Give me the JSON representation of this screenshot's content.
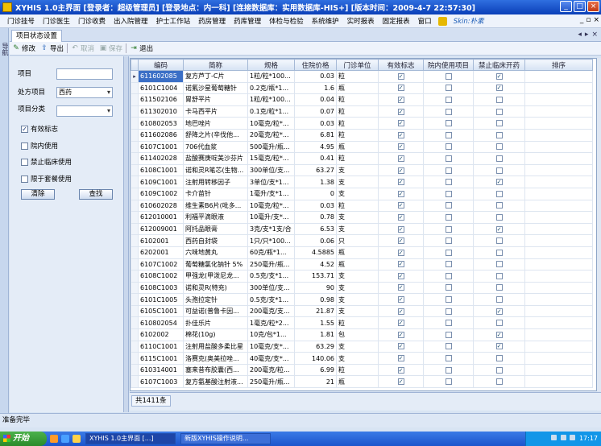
{
  "window": {
    "title": "XYHIS 1.0主界面  [登录者：超级管理员] [登录地点：内一科] [连接数据库：实用数据库-HIS+] [版本时间：2009-4-7 22:57:30]"
  },
  "menu": {
    "items": [
      "门诊挂号",
      "门诊医生",
      "门诊收费",
      "出入院管理",
      "护士工作站",
      "药房管理",
      "药库管理",
      "体检与检验",
      "系统维护",
      "实时报表",
      "固定报表",
      "窗口"
    ],
    "skin": "Skin:朴素"
  },
  "leftbar": {
    "label": "导航"
  },
  "tab": {
    "label": "项目状态设置"
  },
  "toolbar": {
    "modify": "修改",
    "export": "导出",
    "cancel": "取消",
    "save": "保存",
    "exit": "退出"
  },
  "filter": {
    "item_label": "项目",
    "item_value": "",
    "pharmacy_label": "处方项目",
    "pharmacy_value": "西药",
    "category_label": "项目分类",
    "category_value": "",
    "chk_valid": "有效标志",
    "chk_valid_checked": true,
    "chk_inhouse": "院内使用",
    "chk_inhouse_checked": false,
    "chk_banned": "禁止临床使用",
    "chk_banned_checked": false,
    "chk_restrict": "限于套餐使用",
    "chk_restrict_checked": false,
    "clear": "清除",
    "search": "查找"
  },
  "grid": {
    "columns": [
      "编码",
      "简称",
      "规格",
      "住院价格",
      "门诊单位",
      "有效标志",
      "院内使用项目",
      "禁止临床开药",
      "排序"
    ],
    "rows": [
      {
        "code": "611602085",
        "name": "复方芦丁-C片",
        "spec": "1粒/粒*100...",
        "price": "0.03",
        "unit": "粒",
        "valid": true,
        "inhouse": false,
        "ban": true
      },
      {
        "code": "6101C1004",
        "name": "诺氟沙星葡萄糖针",
        "spec": "0.2克/瓶*1...",
        "price": "1.6",
        "unit": "瓶",
        "valid": true,
        "inhouse": false,
        "ban": true
      },
      {
        "code": "611502106",
        "name": "胃舒平片",
        "spec": "1粒/粒*100...",
        "price": "0.04",
        "unit": "粒",
        "valid": true,
        "inhouse": false,
        "ban": false
      },
      {
        "code": "611302010",
        "name": "卡马西平片",
        "spec": "0.1克/粒*1...",
        "price": "0.07",
        "unit": "粒",
        "valid": true,
        "inhouse": false,
        "ban": false
      },
      {
        "code": "610802053",
        "name": "地巴唑片",
        "spec": "10毫克/粒*...",
        "price": "0.03",
        "unit": "粒",
        "valid": true,
        "inhouse": false,
        "ban": false
      },
      {
        "code": "611602086",
        "name": "舒降之片(辛伐他...",
        "spec": "20毫克/粒*...",
        "price": "6.81",
        "unit": "粒",
        "valid": true,
        "inhouse": false,
        "ban": false
      },
      {
        "code": "6107C1001",
        "name": "706代血浆",
        "spec": "500毫升/瓶...",
        "price": "4.95",
        "unit": "瓶",
        "valid": true,
        "inhouse": false,
        "ban": false
      },
      {
        "code": "611402028",
        "name": "盐酸赛庚啶美沙芬片",
        "spec": "15毫克/粒*...",
        "price": "0.41",
        "unit": "粒",
        "valid": true,
        "inhouse": false,
        "ban": false
      },
      {
        "code": "6108C1001",
        "name": "诺和灵R笔芯(生物...",
        "spec": "300单位/支...",
        "price": "63.27",
        "unit": "支",
        "valid": true,
        "inhouse": false,
        "ban": false
      },
      {
        "code": "6109C1001",
        "name": "注射用转移因子",
        "spec": "3单位/支*1...",
        "price": "1.38",
        "unit": "支",
        "valid": true,
        "inhouse": false,
        "ban": true
      },
      {
        "code": "6109C1002",
        "name": "卡介苗针",
        "spec": "1毫升/支*1...",
        "price": "0",
        "unit": "支",
        "valid": true,
        "inhouse": false,
        "ban": false
      },
      {
        "code": "610602028",
        "name": "维生素B6片(吡多...",
        "spec": "10毫克/粒*...",
        "price": "0.03",
        "unit": "粒",
        "valid": true,
        "inhouse": false,
        "ban": false
      },
      {
        "code": "612010001",
        "name": "利福平滴眼液",
        "spec": "10毫升/支*...",
        "price": "0.78",
        "unit": "支",
        "valid": true,
        "inhouse": false,
        "ban": false
      },
      {
        "code": "612009001",
        "name": "阿托品眼膏",
        "spec": "3克/支*1支/合",
        "price": "6.53",
        "unit": "支",
        "valid": true,
        "inhouse": false,
        "ban": true
      },
      {
        "code": "6102001",
        "name": "西药自封袋",
        "spec": "1只/只*100...",
        "price": "0.06",
        "unit": "只",
        "valid": true,
        "inhouse": false,
        "ban": false
      },
      {
        "code": "6202001",
        "name": "六味地黄丸",
        "spec": "60克/瓶*1...",
        "price": "4.5885",
        "unit": "瓶",
        "valid": true,
        "inhouse": false,
        "ban": false
      },
      {
        "code": "6107C1002",
        "name": "葡萄糖氯化钠针 5%",
        "spec": "250毫升/瓶...",
        "price": "4.52",
        "unit": "瓶",
        "valid": true,
        "inhouse": false,
        "ban": false
      },
      {
        "code": "6108C1002",
        "name": "甲强龙(甲泼尼龙...",
        "spec": "0.5克/支*1...",
        "price": "153.71",
        "unit": "支",
        "valid": true,
        "inhouse": false,
        "ban": false
      },
      {
        "code": "6108C1003",
        "name": "诺和灵R(特充)",
        "spec": "300单位/支...",
        "price": "90",
        "unit": "支",
        "valid": true,
        "inhouse": false,
        "ban": false
      },
      {
        "code": "6101C1005",
        "name": "头孢拉定针",
        "spec": "0.5克/支*1...",
        "price": "0.98",
        "unit": "支",
        "valid": true,
        "inhouse": false,
        "ban": false
      },
      {
        "code": "6105C1001",
        "name": "可益诺(普鲁卡因...",
        "spec": "200毫克/支...",
        "price": "21.87",
        "unit": "支",
        "valid": true,
        "inhouse": false,
        "ban": true
      },
      {
        "code": "610802054",
        "name": "扑佳乐片",
        "spec": "1毫克/粒*2...",
        "price": "1.55",
        "unit": "粒",
        "valid": true,
        "inhouse": false,
        "ban": false
      },
      {
        "code": "6102002",
        "name": "棉花(10g)",
        "spec": "10克/包*1...",
        "price": "1.81",
        "unit": "包",
        "valid": true,
        "inhouse": false,
        "ban": true
      },
      {
        "code": "6110C1001",
        "name": "注射用盐酸多柔比星",
        "spec": "10毫克/支*...",
        "price": "63.29",
        "unit": "支",
        "valid": true,
        "inhouse": false,
        "ban": true
      },
      {
        "code": "6115C1001",
        "name": "洛赛克(奥美拉唑...",
        "spec": "40毫克/支*...",
        "price": "140.06",
        "unit": "支",
        "valid": true,
        "inhouse": false,
        "ban": false
      },
      {
        "code": "610314001",
        "name": "塞来昔布胶囊(西...",
        "spec": "200毫克/粒...",
        "price": "6.99",
        "unit": "粒",
        "valid": true,
        "inhouse": false,
        "ban": false
      },
      {
        "code": "6107C1003",
        "name": "复方氨基酸注射液...",
        "spec": "250毫升/瓶...",
        "price": "21",
        "unit": "瓶",
        "valid": true,
        "inhouse": false,
        "ban": false
      }
    ],
    "count": "共1411条"
  },
  "status": {
    "text": "准备完毕"
  },
  "taskbar": {
    "start": "开始",
    "tasks": [
      "XYHIS 1.0主界面 [...]",
      "新版XYHIS操作说明..."
    ],
    "time": "17:17"
  }
}
